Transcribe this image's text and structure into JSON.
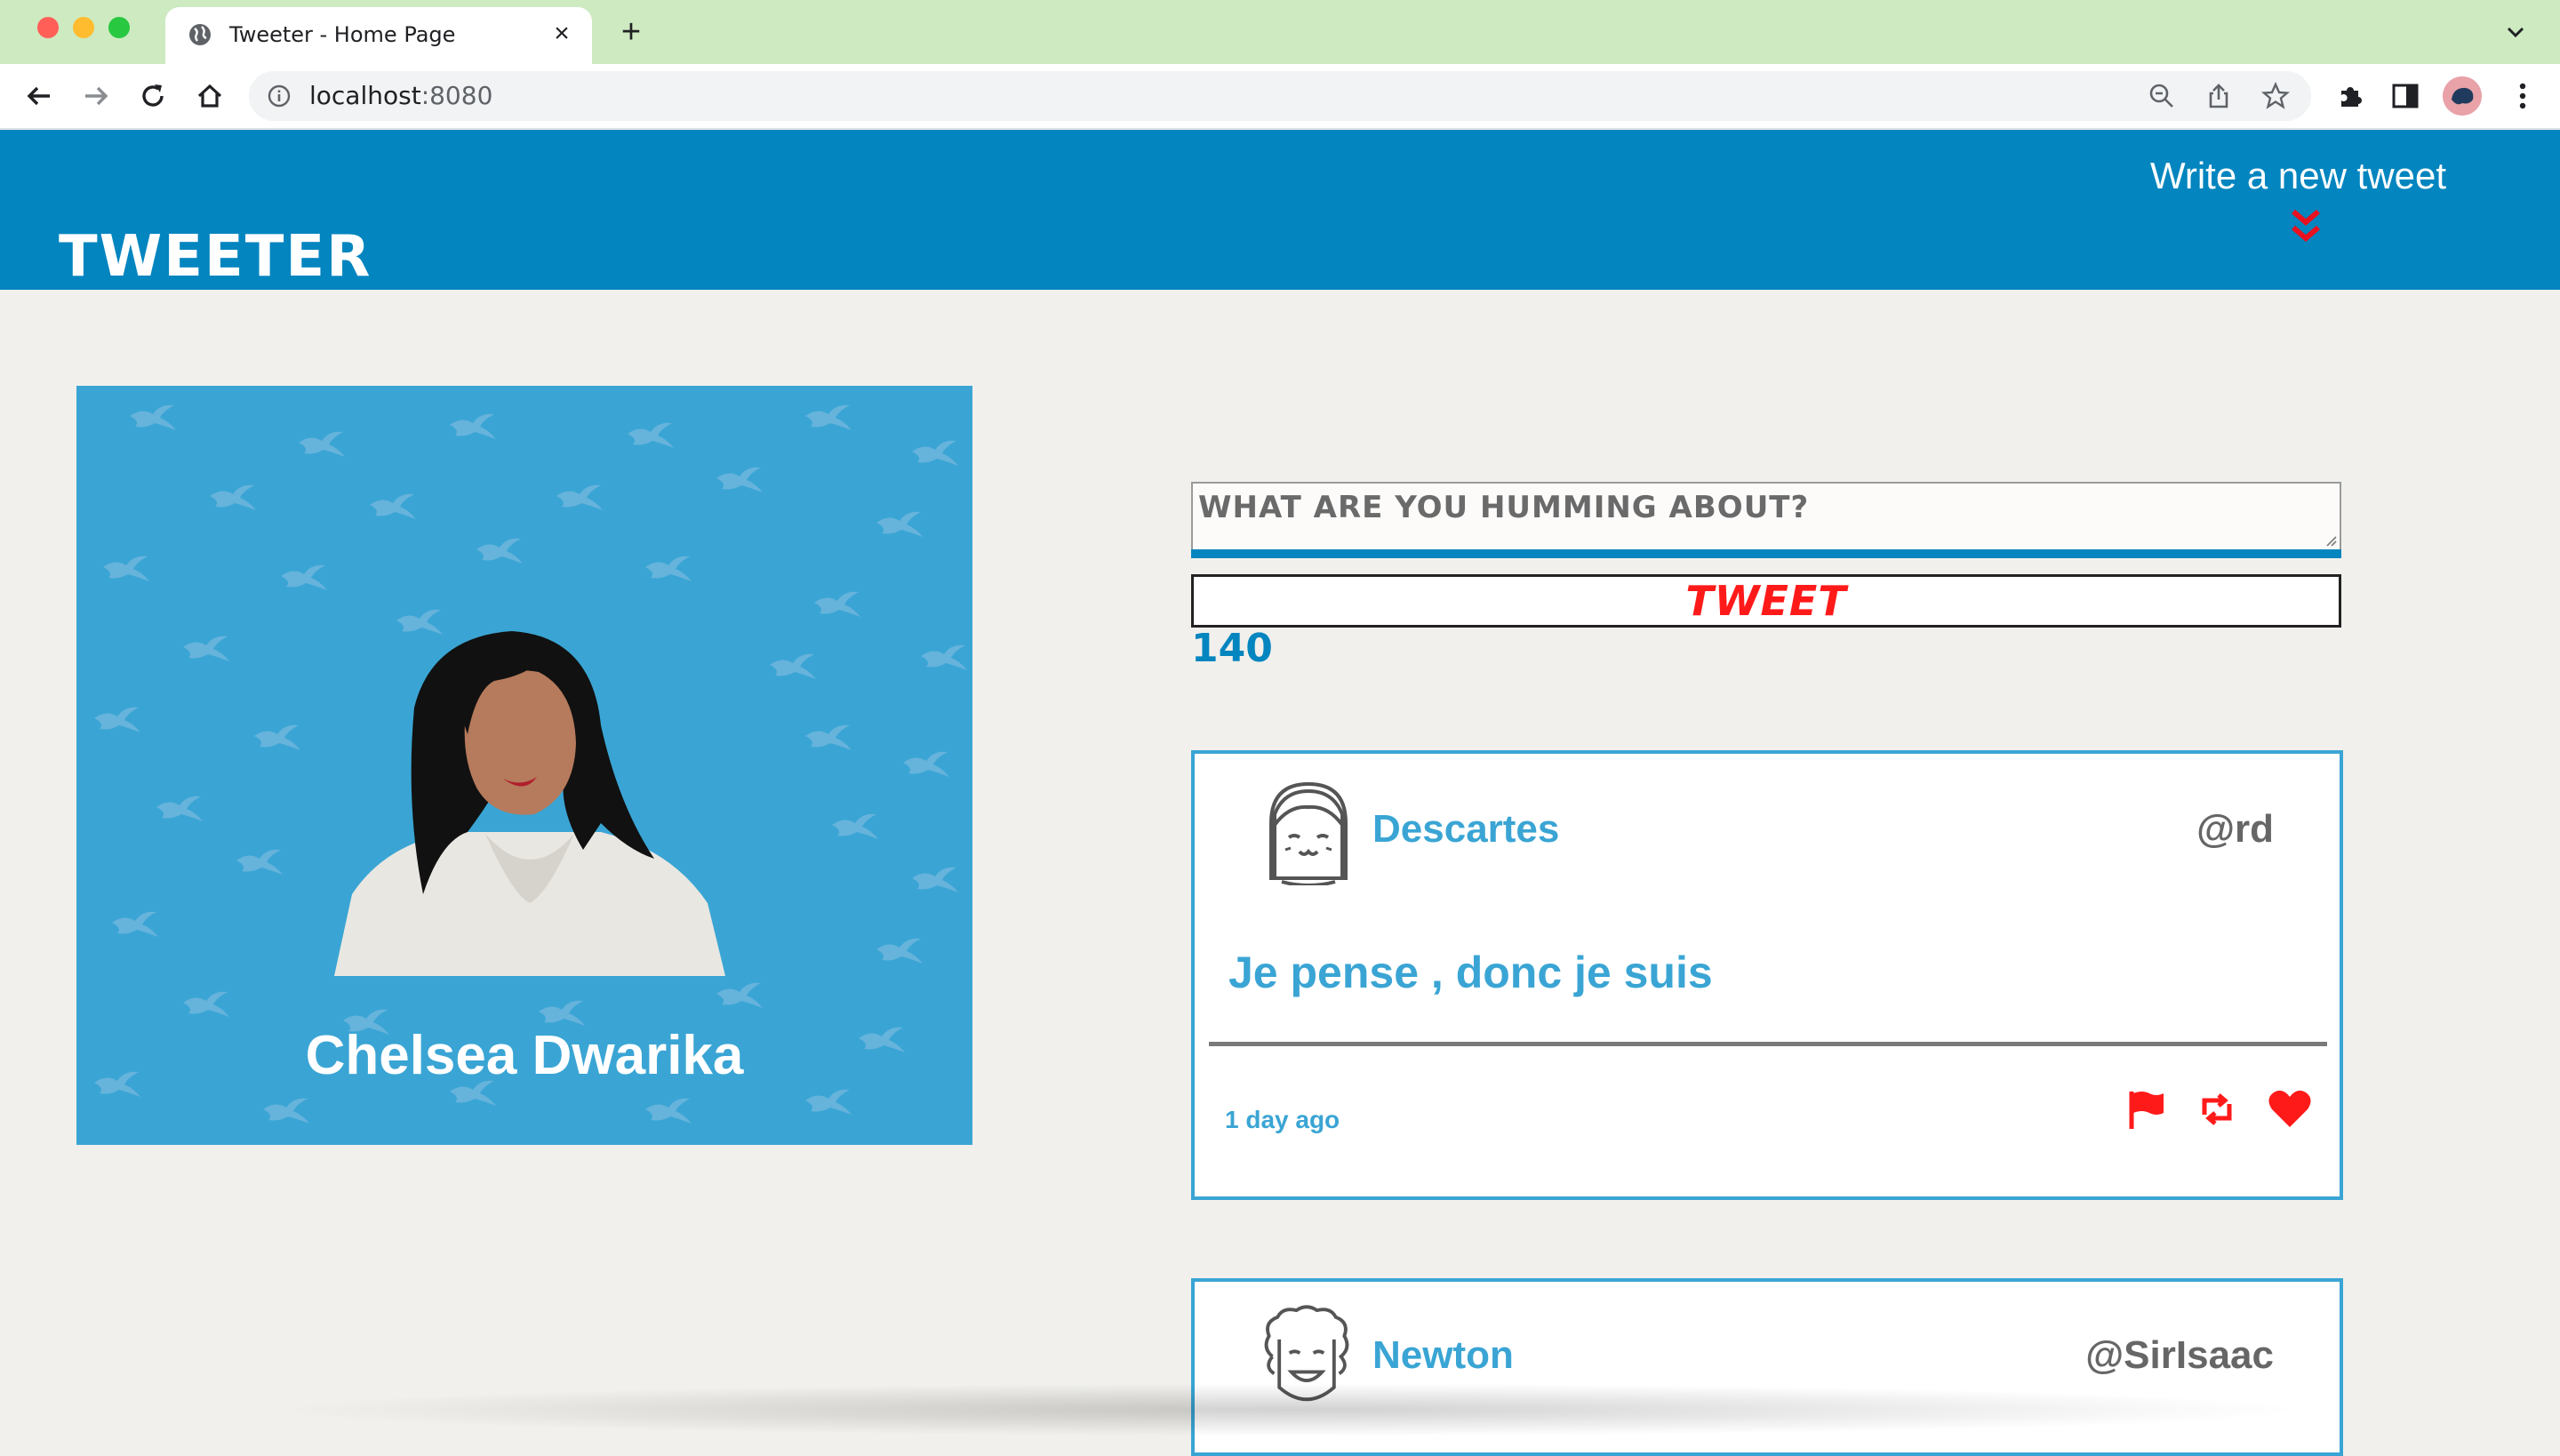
{
  "browser": {
    "tab_title": "Tweeter - Home Page",
    "tab_close": "×",
    "new_tab": "+",
    "url_host": "localhost",
    "url_port": ":8080"
  },
  "header": {
    "logo": "TWEETER",
    "write_link": "Write a new tweet"
  },
  "profile": {
    "name": "Chelsea Dwarika"
  },
  "composer": {
    "placeholder": "WHAT ARE YOU HUMMING ABOUT?",
    "submit_label": "TWEET",
    "counter": "140"
  },
  "tweets": [
    {
      "author": "Descartes",
      "handle": "@rd",
      "text": "Je pense , donc je suis",
      "time": "1 day ago"
    },
    {
      "author": "Newton",
      "handle": "@SirIsaac"
    }
  ],
  "colors": {
    "header_blue": "#0385bf",
    "accent_blue": "#3aa5d4",
    "action_red": "#ff1a1a",
    "page_bg": "#f1f0ec"
  }
}
